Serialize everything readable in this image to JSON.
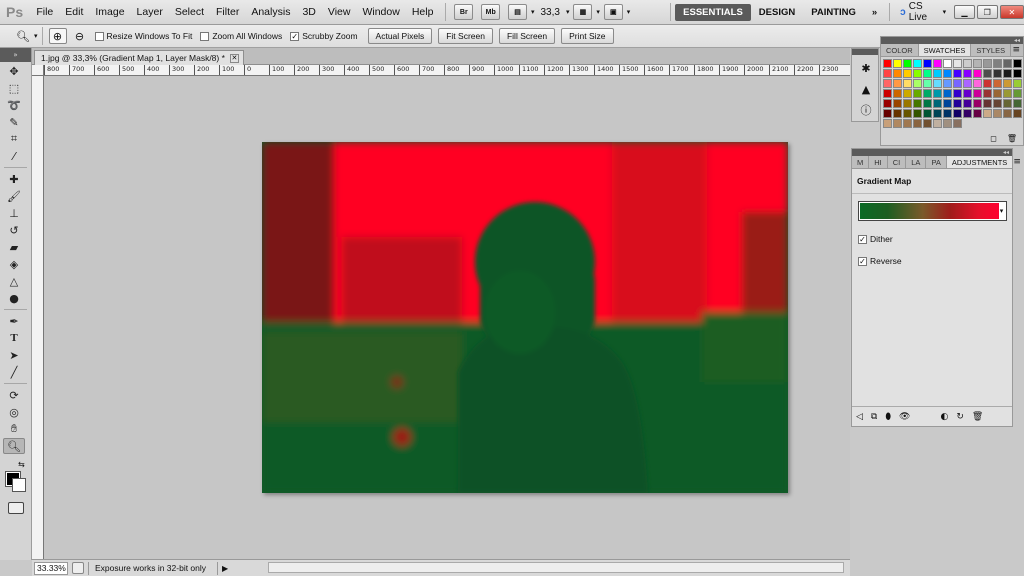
{
  "app": {
    "logo": "Ps",
    "menus": [
      "File",
      "Edit",
      "Image",
      "Layer",
      "Select",
      "Filter",
      "Analysis",
      "3D",
      "View",
      "Window",
      "Help"
    ],
    "bridge_label": "Br",
    "minibridge_label": "Mb",
    "zoom_level": "33,3",
    "workspaces": [
      "ESSENTIALS",
      "DESIGN",
      "PAINTING"
    ],
    "active_workspace": "ESSENTIALS",
    "more_workspaces": "»",
    "cs_live": "CS Live"
  },
  "options_bar": {
    "resize_windows": "Resize Windows To Fit",
    "zoom_all_windows": "Zoom All Windows",
    "scrubby_zoom": "Scrubby Zoom",
    "actual_pixels": "Actual Pixels",
    "fit_screen": "Fit Screen",
    "fill_screen": "Fill Screen",
    "print_size": "Print Size"
  },
  "document": {
    "tab_title": "1.jpg @ 33,3% (Gradient Map 1, Layer Mask/8) *",
    "ruler_labels": [
      "800",
      "700",
      "600",
      "500",
      "400",
      "300",
      "200",
      "100",
      "0",
      "100",
      "200",
      "300",
      "400",
      "500",
      "600",
      "700",
      "800",
      "900",
      "1000",
      "1100",
      "1200",
      "1300",
      "1400",
      "1500",
      "1600",
      "1700",
      "1800",
      "1900",
      "2000",
      "2100",
      "2200",
      "2300"
    ]
  },
  "status": {
    "zoom": "33.33%",
    "message": "Exposure works in 32-bit only"
  },
  "swatches_panel": {
    "tabs": [
      "COLOR",
      "SWATCHES",
      "STYLES"
    ],
    "active_tab": "SWATCHES"
  },
  "adjustments_panel": {
    "tabs": [
      "M",
      "HI",
      "CI",
      "LA",
      "PA",
      "ADJUSTMENTS"
    ],
    "active_tab": "ADJUSTMENTS",
    "title": "Gradient Map",
    "gradient_colors": [
      "#0a6a25",
      "#e4102a"
    ],
    "dither_label": "Dither",
    "reverse_label": "Reverse"
  },
  "colors": {
    "foreground": "#000000",
    "background": "#ffffff",
    "image_red": "#ff0022",
    "image_green": "#0b5a28"
  }
}
